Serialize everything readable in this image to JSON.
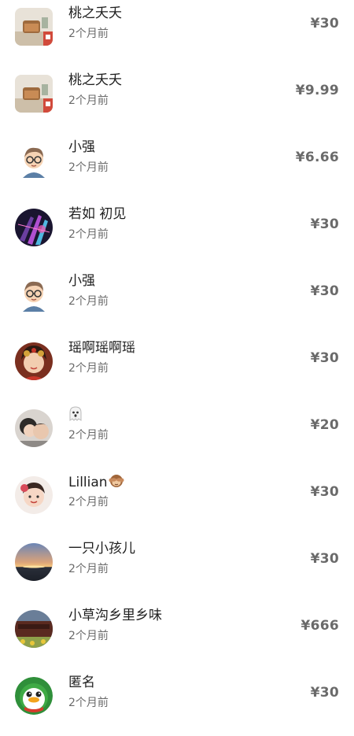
{
  "rows": [
    {
      "name": "桃之夭夭",
      "time": "2个月前",
      "amount": "¥30",
      "avatar": "room-icon"
    },
    {
      "name": "桃之夭夭",
      "time": "2个月前",
      "amount": "¥9.99",
      "avatar": "room-icon"
    },
    {
      "name": "小强",
      "time": "2个月前",
      "amount": "¥6.66",
      "avatar": "cartoon-man-icon"
    },
    {
      "name": "若如 初见",
      "time": "2个月前",
      "amount": "¥30",
      "avatar": "abstract-light-icon"
    },
    {
      "name": "小强",
      "time": "2个月前",
      "amount": "¥30",
      "avatar": "cartoon-man-icon"
    },
    {
      "name": "瑶啊瑶啊瑶",
      "time": "2个月前",
      "amount": "¥30",
      "avatar": "portrait-icon"
    },
    {
      "name": "",
      "time": "2个月前",
      "amount": "¥20",
      "avatar": "kids-photo-icon"
    },
    {
      "name": "Lillian",
      "time": "2个月前",
      "amount": "¥30",
      "avatar": "child-photo-icon"
    },
    {
      "name": "一只小孩儿",
      "time": "2个月前",
      "amount": "¥30",
      "avatar": "sunset-icon"
    },
    {
      "name": "小草沟乡里乡味",
      "time": "2个月前",
      "amount": "¥666",
      "avatar": "shop-front-icon"
    },
    {
      "name": "匿名",
      "time": "2个月前",
      "amount": "¥30",
      "avatar": "qq-penguin-icon"
    }
  ]
}
